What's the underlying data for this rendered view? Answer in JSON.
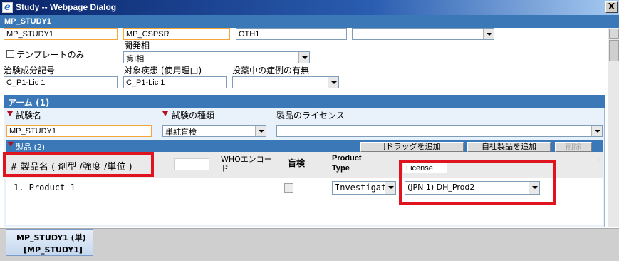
{
  "window": {
    "title": "Study -- Webpage Dialog",
    "close_label": "X"
  },
  "header": {
    "study_label": "MP_STUDY1"
  },
  "top_fields": {
    "study_id": "MP_STUDY1",
    "sponsor": "MP_CSPSR",
    "type": "OTH1",
    "template_only_label": "テンプレートのみ",
    "phase_label": "開発相",
    "phase_value": "第Ⅰ相",
    "compound_label": "治験成分記号",
    "compound_value": "C_P1-Lic 1",
    "disease_label": "対象疾患 (使用理由)",
    "disease_value": "C_P1-Lic 1",
    "ongoing_label": "投薬中の症例の有無"
  },
  "arm": {
    "title": "アーム (1)",
    "trial_name_label": "試験名",
    "trial_name_value": "MP_STUDY1",
    "trial_type_label": "試験の種類",
    "trial_type_value": "単純盲検",
    "license_label": "製品のライセンス"
  },
  "products": {
    "title": "製品 (2)",
    "btn_add_drug": "Jドラッグを追加",
    "btn_add_own": "自社製品を追加",
    "btn_delete": "削除",
    "columns": {
      "name": "# 製品名 ( 剤型 /強度 /単位 )",
      "who": "WHOエンコード",
      "blind": "盲検",
      "product_type": "Product Type",
      "license": "License"
    },
    "rows": [
      {
        "name": "1. Product 1",
        "product_type": "Investigat",
        "license": "(JPN 1) DH_Prod2"
      }
    ]
  },
  "tabs": {
    "line1": "MP_STUDY1 (単)",
    "line2": "[MP_STUDY1]"
  },
  "colors": {
    "accent": "#3b78b8",
    "highlight": "#e0141e",
    "required_border": "#f4a63c"
  }
}
